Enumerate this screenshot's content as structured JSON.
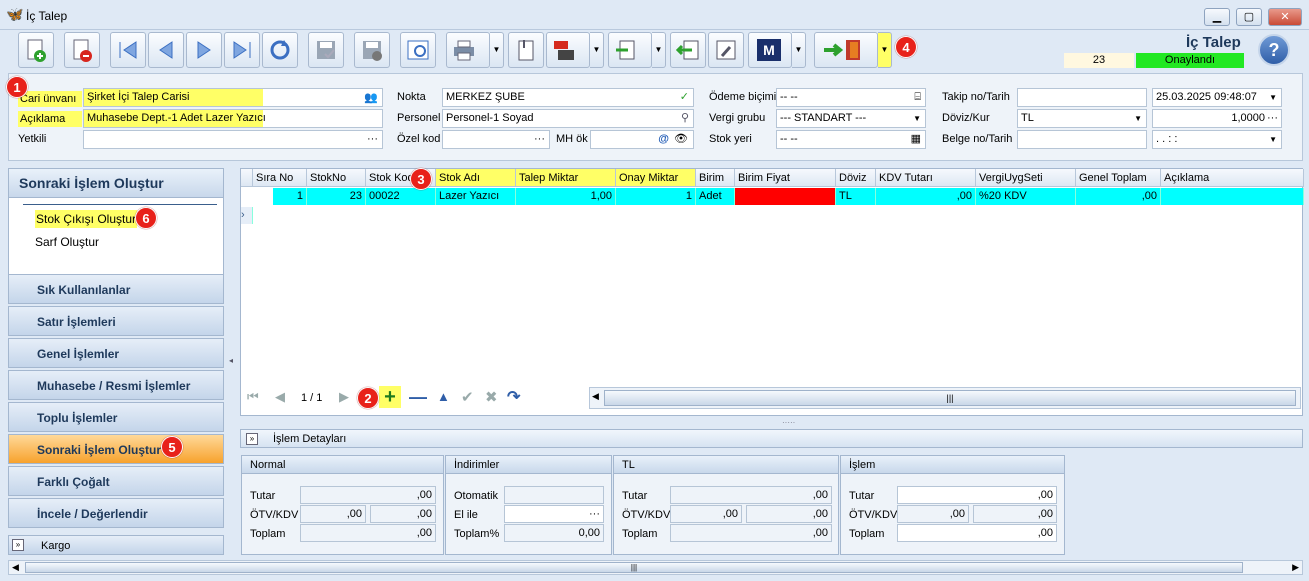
{
  "window": {
    "title": "İç Talep",
    "min": "▁",
    "max": "▢",
    "close": "✕"
  },
  "status": {
    "title": "İç Talep",
    "number": "23",
    "state": "Onaylandı",
    "help": "?"
  },
  "toolbar": {
    "m_label": "M"
  },
  "badges": [
    "1",
    "2",
    "3",
    "4",
    "5",
    "6"
  ],
  "form": {
    "cari_label": "Cari ünvanı",
    "cari_value": "Şirket İçi Talep Carisi",
    "aciklama_label": "Açıklama",
    "aciklama_value": "Muhasebe Dept.-1 Adet Lazer Yazıcı",
    "yetkili_label": "Yetkili",
    "nokta_label": "Nokta",
    "nokta_value": "MERKEZ ŞUBE",
    "personel_label": "Personel",
    "personel_value": "Personel-1 Soyad",
    "ozelkod_label": "Özel kod",
    "mhok_label": "MH ök",
    "odeme_label": "Ödeme biçimi",
    "odeme_value": "-- --",
    "vergi_label": "Vergi grubu",
    "vergi_value": "--- STANDART ---",
    "stokyeri_label": "Stok yeri",
    "stokyeri_value": "-- --",
    "takip_label": "Takip no/Tarih",
    "takip_date": "25.03.2025 09:48:07",
    "doviz_label": "Döviz/Kur",
    "doviz_value": "TL",
    "kur_value": "1,0000",
    "belge_label": "Belge no/Tarih",
    "belge_date": ". .   : :"
  },
  "sidebar": {
    "title": "Sonraki İşlem Oluştur",
    "links": [
      "Stok Çıkışı Oluştur",
      "Sarf Oluştur"
    ],
    "groups": [
      "Sık Kullanılanlar",
      "Satır İşlemleri",
      "Genel İşlemler",
      "Muhasebe / Resmi İşlemler",
      "Toplu İşlemler",
      "Sonraki İşlem Oluştur",
      "Farklı Çoğalt",
      "İncele / Değerlendir"
    ],
    "footer": "Kargo"
  },
  "grid": {
    "columns": [
      "Sıra No",
      "StokNo",
      "Stok Kodu",
      "Stok Adı",
      "Talep Miktar",
      "Onay Miktar",
      "Birim",
      "Birim Fiyat",
      "Döviz",
      "KDV Tutarı",
      "VergiUygSeti",
      "Genel Toplam",
      "Açıklama"
    ],
    "row": {
      "sira": "1",
      "stokno": "23",
      "kod": "00022",
      "adi": "Lazer Yazıcı",
      "talep": "1,00",
      "onay": "1",
      "birim": "Adet",
      "fiyat": "",
      "doviz": "TL",
      "kdv": ",00",
      "vergi": "%20 KDV",
      "toplam": ",00",
      "aciklama": ""
    },
    "page": "1 / 1"
  },
  "details": {
    "header": "İşlem Detayları",
    "groups": [
      {
        "title": "Normal",
        "rows": [
          {
            "label": "Tutar",
            "v1": ",00"
          },
          {
            "label": "ÖTV/KDV",
            "v1": ",00",
            "v2": ",00"
          },
          {
            "label": "Toplam",
            "v1": ",00"
          }
        ]
      },
      {
        "title": "İndirimler",
        "rows": [
          {
            "label": "Otomatik",
            "v1": ""
          },
          {
            "label": "El ile",
            "v1": ""
          },
          {
            "label": "Toplam%",
            "v1": "0,00"
          }
        ]
      },
      {
        "title": "TL",
        "rows": [
          {
            "label": "Tutar",
            "v1": ",00"
          },
          {
            "label": "ÖTV/KDV",
            "v1": ",00",
            "v2": ",00"
          },
          {
            "label": "Toplam",
            "v1": ",00"
          }
        ]
      },
      {
        "title": "İşlem",
        "rows": [
          {
            "label": "Tutar",
            "v1": ",00"
          },
          {
            "label": "ÖTV/KDV",
            "v1": ",00",
            "v2": ",00"
          },
          {
            "label": "Toplam",
            "v1": ",00"
          }
        ]
      }
    ]
  },
  "colors": {
    "highlight": "#ffff66",
    "status_ok": "#22e822",
    "row": "#00ffff",
    "price_cell": "#ff0000",
    "badge": "#e8211a"
  }
}
